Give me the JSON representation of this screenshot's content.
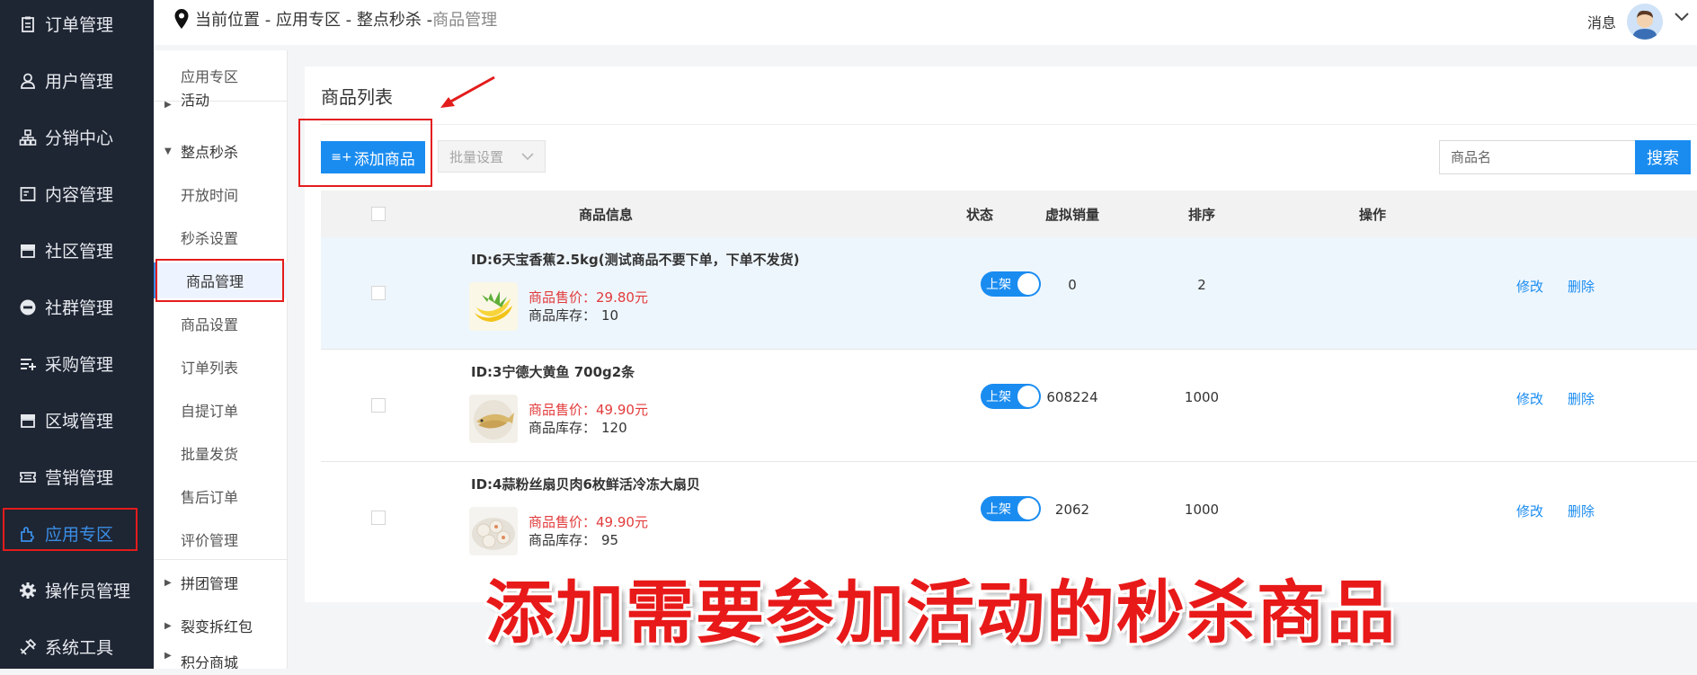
{
  "sidebar": {
    "items": [
      {
        "label": "订单管理",
        "icon": "clipboard-icon"
      },
      {
        "label": "用户管理",
        "icon": "user-icon"
      },
      {
        "label": "分销中心",
        "icon": "org-chart-icon"
      },
      {
        "label": "内容管理",
        "icon": "document-icon"
      },
      {
        "label": "社区管理",
        "icon": "store-icon"
      },
      {
        "label": "社群管理",
        "icon": "minus-circle-icon"
      },
      {
        "label": "采购管理",
        "icon": "list-add-icon"
      },
      {
        "label": "区域管理",
        "icon": "store-icon"
      },
      {
        "label": "营销管理",
        "icon": "ticket-icon"
      },
      {
        "label": "应用专区",
        "icon": "puzzle-icon"
      },
      {
        "label": "操作员管理",
        "icon": "gear-icon"
      },
      {
        "label": "系统工具",
        "icon": "tools-icon"
      }
    ],
    "active_index": 9
  },
  "breadcrumb": {
    "prefix": "当前位置 - 应用专区 - 整点秒杀 - ",
    "current": "商品管理"
  },
  "header": {
    "messages_label": "消息"
  },
  "subnav": {
    "title": "应用专区",
    "partial_top": "活动",
    "group_seckill": "整点秒杀",
    "items": [
      "开放时间",
      "秒杀设置",
      "商品管理",
      "商品设置",
      "订单列表",
      "自提订单",
      "批量发货",
      "售后订单",
      "评价管理"
    ],
    "active_item": "商品管理",
    "group_pintuan": "拼团管理",
    "group_redpacket": "裂变拆红包",
    "partial_bottom": "积分商城"
  },
  "main": {
    "title": "商品列表",
    "add_button": "添加商品",
    "batch_select": "批量设置",
    "search_placeholder": "商品名",
    "search_button": "搜索"
  },
  "table": {
    "columns": [
      "商品信息",
      "状态",
      "虚拟销量",
      "排序",
      "操作"
    ],
    "price_label": "商品售价：",
    "stock_label": "商品库存：",
    "rows": [
      {
        "title": "ID:6天宝香蕉2.5kg(测试商品不要下单，下单不发货)",
        "price": "29.80元",
        "stock": "10",
        "status": "上架",
        "virtual_sales": "0",
        "sort": "2",
        "edit": "修改",
        "delete": "删除"
      },
      {
        "title": "ID:3宁德大黄鱼 700g2条",
        "price": "49.90元",
        "stock": "120",
        "status": "上架",
        "virtual_sales": "608224",
        "sort": "1000",
        "edit": "修改",
        "delete": "删除"
      },
      {
        "title": "ID:4蒜粉丝扇贝肉6枚鲜活冷冻大扇贝",
        "price": "49.90元",
        "stock": "95",
        "status": "上架",
        "virtual_sales": "2062",
        "sort": "1000",
        "edit": "修改",
        "delete": "删除"
      }
    ]
  },
  "caption": "添加需要参加活动的秒杀商品",
  "colors": {
    "sidebar_bg": "#1e2533",
    "accent": "#1a8cf0",
    "highlight_box": "#e31c1c",
    "price": "#e23b3b"
  }
}
